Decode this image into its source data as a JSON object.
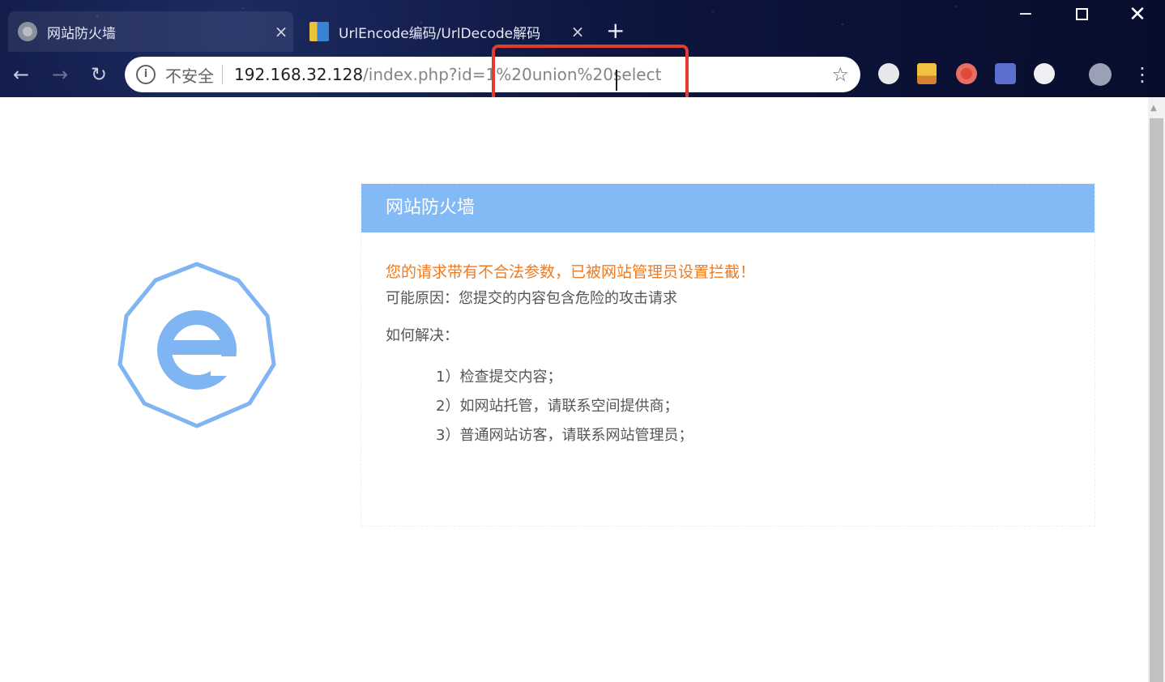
{
  "browser": {
    "tabs": [
      {
        "title": "网站防火墙",
        "close": "×"
      },
      {
        "title": "UrlEncode编码/UrlDecode解码",
        "close": "×"
      }
    ],
    "new_tab": "+",
    "window": {
      "minimize": "−",
      "close": "✕"
    },
    "nav": {
      "back": "←",
      "forward": "→",
      "reload": "↻"
    },
    "omnibox": {
      "info": "i",
      "security": "不安全",
      "host": "192.168.32.128",
      "path": "/index.php?id=1%20union%20select",
      "star": "☆"
    },
    "menu": "⋮",
    "icons": [
      "info-icon",
      "star-icon",
      "extension-icons",
      "profile-icon"
    ]
  },
  "firewall": {
    "header": "网站防火墙",
    "warning": "您的请求带有不合法参数，已被网站管理员设置拦截！",
    "reason": "可能原因：您提交的内容包含危险的攻击请求",
    "howto": "如何解决：",
    "steps": [
      "1）检查提交内容；",
      "2）如网站托管，请联系空间提供商；",
      "3）普通网站访客，请联系网站管理员；"
    ]
  },
  "colors": {
    "chrome_bg": "#0d1640",
    "panel_header": "#83b9f5",
    "warning_text": "#f07a20",
    "highlight": "#e53b2c",
    "shield": "#7fb5f3"
  }
}
